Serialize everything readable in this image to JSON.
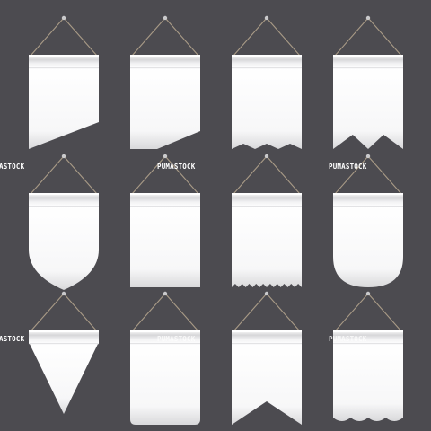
{
  "watermarks": [
    {
      "text": "ASTOCK"
    },
    {
      "text": "PUMASTOCK"
    },
    {
      "text": "PUMASTOCK"
    },
    {
      "text": "ASTOCK"
    },
    {
      "text": "PUMASTOCK"
    },
    {
      "text": "PUMASTOCK"
    }
  ],
  "pennants": [
    {
      "shape": "slanted-bottom"
    },
    {
      "shape": "cut-corner"
    },
    {
      "shape": "zigzag-bottom"
    },
    {
      "shape": "swallowtail-two-notches"
    },
    {
      "shape": "shield-point"
    },
    {
      "shape": "rectangle"
    },
    {
      "shape": "scalloped-bottom"
    },
    {
      "shape": "rounded-bottom"
    },
    {
      "shape": "triangle"
    },
    {
      "shape": "rounded-corners-rectangle"
    },
    {
      "shape": "swallowtail"
    },
    {
      "shape": "wavy-bottom"
    }
  ],
  "colors": {
    "background": "#4c4b50",
    "fabric_light": "#ffffff",
    "fabric_shade": "#d4d4d6",
    "string": "#a89a86",
    "nail": "#c9c9cb"
  }
}
